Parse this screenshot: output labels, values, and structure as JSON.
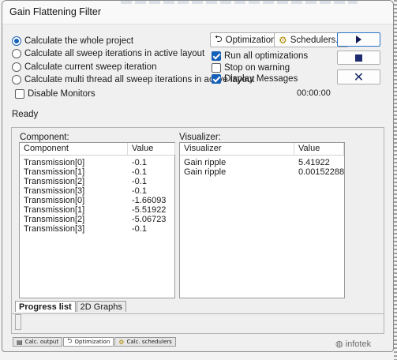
{
  "window": {
    "title": "Gain Flattening Filter"
  },
  "run_options": [
    {
      "label": "Calculate the whole project",
      "selected": true
    },
    {
      "label": "Calculate all sweep iterations in active layout",
      "selected": false
    },
    {
      "label": "Calculate current sweep iteration",
      "selected": false
    },
    {
      "label": "Calculate multi thread all sweep iterations in active layout",
      "selected": false
    }
  ],
  "disable_monitors": {
    "label": "Disable Monitors",
    "checked": false
  },
  "toolbar": {
    "optimizations_label": "Optimizations",
    "schedulers_label": "Schedulers..."
  },
  "options": {
    "run_all": {
      "label": "Run all optimizations",
      "checked": true
    },
    "stop_on_warning": {
      "label": "Stop on warning",
      "checked": false
    },
    "display_messages": {
      "label": "Display Messages",
      "checked": true
    }
  },
  "controls": {
    "run_icon": "play-icon",
    "stop_icon": "stop-icon",
    "cancel_icon": "close-icon"
  },
  "timer": "00:00:00",
  "status": "Ready",
  "component_panel": {
    "section_label": "Component:",
    "columns": [
      "Component",
      "Value"
    ],
    "rows": [
      [
        "Transmission[0]",
        "-0.1"
      ],
      [
        "Transmission[1]",
        "-0.1"
      ],
      [
        "Transmission[2]",
        "-0.1"
      ],
      [
        "Transmission[3]",
        "-0.1"
      ],
      [
        "Transmission[0]",
        "-1.66093"
      ],
      [
        "Transmission[1]",
        "-5.51922"
      ],
      [
        "Transmission[2]",
        "-5.06723"
      ],
      [
        "Transmission[3]",
        "-0.1"
      ]
    ]
  },
  "visualizer_panel": {
    "section_label": "Visualizer:",
    "columns": [
      "Visualizer",
      "Value"
    ],
    "rows": [
      [
        "Gain ripple",
        "5.41922"
      ],
      [
        "Gain ripple",
        "0.00152288"
      ]
    ]
  },
  "view_tabs": [
    {
      "label": "Progress list",
      "active": true
    },
    {
      "label": "2D Graphs",
      "active": false
    }
  ],
  "bottom_tabs": [
    {
      "label": "Calc. output",
      "icon": "document-icon",
      "active": false
    },
    {
      "label": "Optimization",
      "icon": "optimization-icon",
      "active": true
    },
    {
      "label": "Calc. schedulers",
      "icon": "scheduler-icon",
      "active": false
    }
  ],
  "watermark": "infotek",
  "colors": {
    "accent": "#1560b8",
    "icon_dark": "#1f2b6f"
  }
}
